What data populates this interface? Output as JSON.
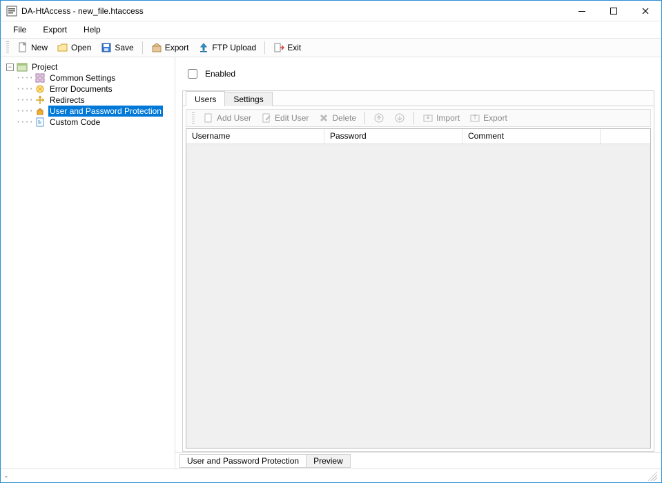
{
  "window": {
    "title": "DA-HtAccess - new_file.htaccess"
  },
  "menu": {
    "file": "File",
    "export": "Export",
    "help": "Help"
  },
  "toolbar": {
    "new": "New",
    "open": "Open",
    "save": "Save",
    "export": "Export",
    "ftp_upload": "FTP Upload",
    "exit": "Exit"
  },
  "tree": {
    "root": "Project",
    "items": [
      "Common Settings",
      "Error Documents",
      "Redirects",
      "User and Password Protection",
      "Custom Code"
    ],
    "selected_index": 3
  },
  "panel": {
    "enabled_label": "Enabled",
    "tabs": {
      "users": "Users",
      "settings": "Settings"
    },
    "sub_toolbar": {
      "add_user": "Add User",
      "edit_user": "Edit User",
      "delete": "Delete",
      "import": "Import",
      "export": "Export"
    },
    "columns": {
      "username": "Username",
      "password": "Password",
      "comment": "Comment"
    }
  },
  "bottom_tabs": {
    "main": "User and Password Protection",
    "preview": "Preview"
  },
  "status": {
    "text": "-"
  }
}
